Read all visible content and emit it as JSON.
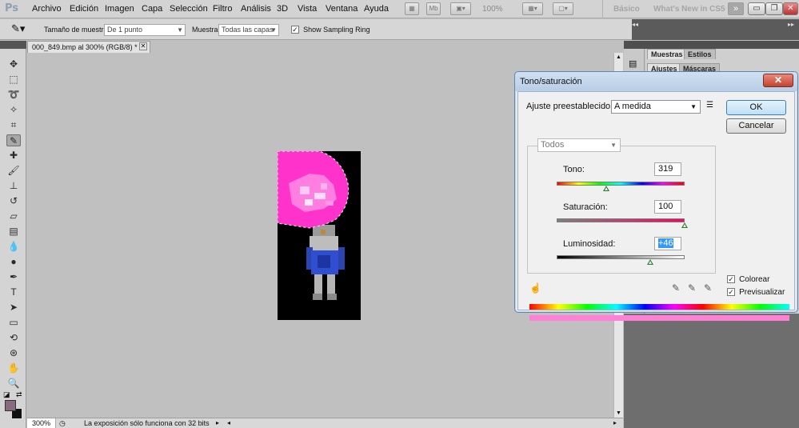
{
  "app": {
    "logo": "Ps",
    "menu": [
      "Archivo",
      "Edición",
      "Imagen",
      "Capa",
      "Selección",
      "Filtro",
      "Análisis",
      "3D",
      "Vista",
      "Ventana",
      "Ayuda"
    ],
    "zoom_display": "100%",
    "workspaces": [
      "Básico",
      "What's New in CS5"
    ]
  },
  "options_bar": {
    "sample_size_label": "Tamaño de muestra:",
    "sample_size_value": "De 1 punto",
    "sample_label": "Muestra:",
    "sample_value": "Todas las capas",
    "sampling_ring_label": "Show Sampling Ring",
    "sampling_ring_checked": true
  },
  "document": {
    "tab_title": "000_849.bmp al 300% (RGB/8) *",
    "zoom": "300%",
    "status_text": "La exposición sólo funciona con 32 bits"
  },
  "panels": {
    "row1": [
      "Muestras",
      "Estilos"
    ],
    "row2": [
      "Ajustes",
      "Máscaras"
    ]
  },
  "dialog": {
    "title": "Tono/saturación",
    "preset_label": "Ajuste preestablecido:",
    "preset_value": "A medida",
    "channel_value": "Todos",
    "ok": "OK",
    "cancel": "Cancelar",
    "hue_label": "Tono:",
    "hue_value": "319",
    "hue_range": [
      -180,
      180
    ],
    "saturation_label": "Saturación:",
    "saturation_value": "100",
    "saturation_range": [
      -100,
      100
    ],
    "lightness_label": "Luminosidad:",
    "lightness_value": "+46",
    "lightness_range": [
      -100,
      100
    ],
    "colorize_label": "Colorear",
    "colorize_checked": true,
    "preview_label": "Previsualizar",
    "preview_checked": true,
    "colorize_color": "#ff80d5"
  },
  "colors": {
    "foreground": "#8a6a7e",
    "background": "#111111",
    "selection_fill": "#ff33cc"
  }
}
